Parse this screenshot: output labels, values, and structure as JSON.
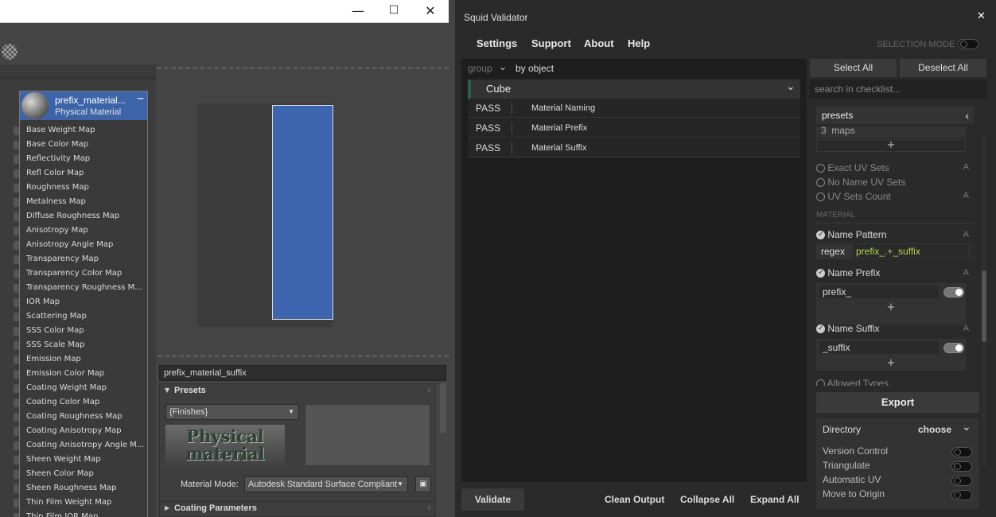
{
  "window": {
    "minimize": "—",
    "maximize": "☐",
    "close": "✕"
  },
  "node": {
    "title": "prefix_material...",
    "subtitle": "Physical Material",
    "collapse": "−",
    "maps": [
      "Base Weight Map",
      "Base Color Map",
      "Reflectivity Map",
      "Refl Color Map",
      "Roughness Map",
      "Metalness Map",
      "Diffuse Roughness Map",
      "Anisotropy Map",
      "Anisotropy Angle Map",
      "Transparency Map",
      "Transparency Color Map",
      "Transparency Roughness M...",
      "IOR Map",
      "Scattering Map",
      "SSS Color Map",
      "SSS Scale Map",
      "Emission Map",
      "Emission Color Map",
      "Coating Weight Map",
      "Coating Color Map",
      "Coating Roughness Map",
      "Coating Anisotropy Map",
      "Coating Anisotropy Angle M...",
      "Sheen Weight Map",
      "Sheen Color Map",
      "Sheen Roughness Map",
      "Thin Film Weight Map",
      "Thin Film IOR Map"
    ]
  },
  "material_panel": {
    "name": "prefix_material_suffix",
    "presets_label": "Presets",
    "preset_value": "{Finishes}",
    "logo_line1": "Physical",
    "logo_line2": "material",
    "mode_label": "Material Mode:",
    "mode_value": "Autodesk Standard Surface Compliant",
    "coating_label": "Coating Parameters"
  },
  "squid": {
    "title": "Squid Validator",
    "close": "✕",
    "menu": [
      "Settings",
      "Support",
      "About",
      "Help"
    ],
    "selection_mode": "SELECTION MODE",
    "group_label": "group",
    "group_value": "by object",
    "object": "Cube",
    "results": [
      {
        "status": "PASS",
        "check": "Material Naming"
      },
      {
        "status": "PASS",
        "check": "Material Prefix"
      },
      {
        "status": "PASS",
        "check": "Material Suffix"
      }
    ],
    "select_all": "Select All",
    "deselect_all": "Deselect All",
    "search_placeholder": "search in checklist...",
    "presets": "presets",
    "maps_partial": "maps",
    "maps_num": "3",
    "add": "+",
    "uv_checks": [
      {
        "label": "Exact UV Sets",
        "tag": "A"
      },
      {
        "label": "No Name UV Sets",
        "tag": ""
      },
      {
        "label": "UV Sets Count",
        "tag": "A"
      }
    ],
    "material_section": "MATERIAL",
    "name_pattern": "Name Pattern",
    "regex_label": "regex",
    "regex_value": "prefix_.+_suffix",
    "name_prefix": "Name Prefix",
    "prefix_value": "prefix_",
    "name_suffix": "Name Suffix",
    "suffix_value": "_suffix",
    "allowed_types": "Allowed Types",
    "tag_a": "A",
    "export": "Export",
    "directory": "Directory",
    "choose": "choose",
    "options": [
      "Version Control",
      "Triangulate",
      "Automatic UV",
      "Move to Origin"
    ],
    "validate": "Validate",
    "clean_output": "Clean Output",
    "collapse_all": "Collapse All",
    "expand_all": "Expand All"
  }
}
